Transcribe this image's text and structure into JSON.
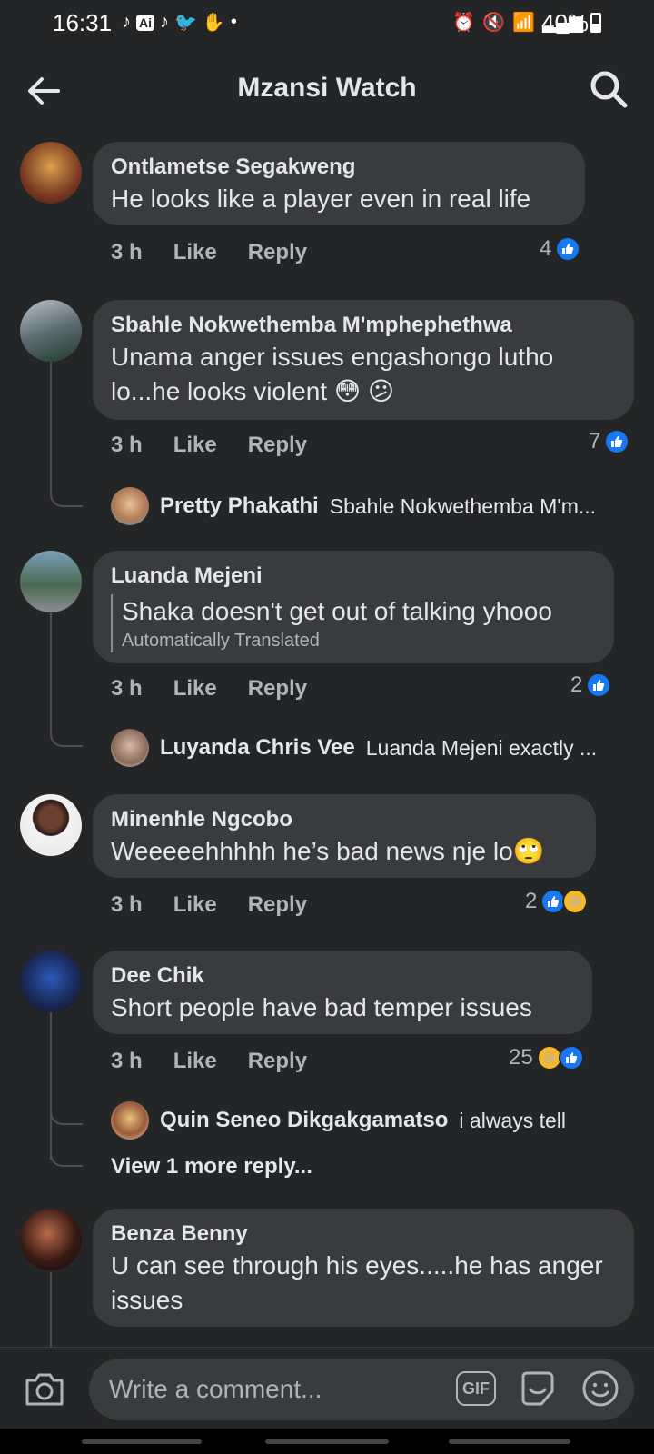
{
  "status": {
    "time": "16:31",
    "ai_badge": "Ai",
    "battery": "40%"
  },
  "header": {
    "title": "Mzansi Watch"
  },
  "comments": [
    {
      "author": "Ontlametse Segakweng",
      "text": "He looks like a player even in real life",
      "time": "3 h",
      "like": "Like",
      "reply": "Reply",
      "reaction_count": "4"
    },
    {
      "author": "Sbahle Nokwethemba M'mphephethwa",
      "text": "Unama anger issues engashongo lutho lo...he looks violent 😳 😕",
      "time": "3 h",
      "like": "Like",
      "reply": "Reply",
      "reaction_count": "7",
      "reply_preview": {
        "author": "Pretty Phakathi",
        "text": "Sbahle Nokwethemba M'm..."
      }
    },
    {
      "author": "Luanda Mejeni",
      "text": "Shaka doesn't get out of talking yhooo",
      "translated_label": "Automatically Translated",
      "time": "3 h",
      "like": "Like",
      "reply": "Reply",
      "reaction_count": "2",
      "reply_preview": {
        "author": "Luyanda Chris Vee",
        "text": "Luanda Mejeni exactly ..."
      }
    },
    {
      "author": "Minenhle Ngcobo",
      "text": "Weeeeehhhhh he’s bad news nje lo🙄",
      "time": "3 h",
      "like": "Like",
      "reply": "Reply",
      "reaction_count": "2"
    },
    {
      "author": "Dee Chik",
      "text": "Short people have bad temper issues",
      "time": "3 h",
      "like": "Like",
      "reply": "Reply",
      "reaction_count": "25",
      "reply_preview": {
        "author": "Quin Seneo Dikgakgamatso",
        "text": "i always tell"
      },
      "view_more": "View 1 more reply..."
    },
    {
      "author": "Benza Benny",
      "text": "U can see through his eyes.....he has anger issues"
    }
  ],
  "composer": {
    "placeholder": "Write a comment...",
    "gif_label": "GIF"
  },
  "colors": {
    "background": "#242526",
    "bubble": "#3a3b3c",
    "like_blue": "#1877f2",
    "haha_yellow": "#f7b928"
  }
}
